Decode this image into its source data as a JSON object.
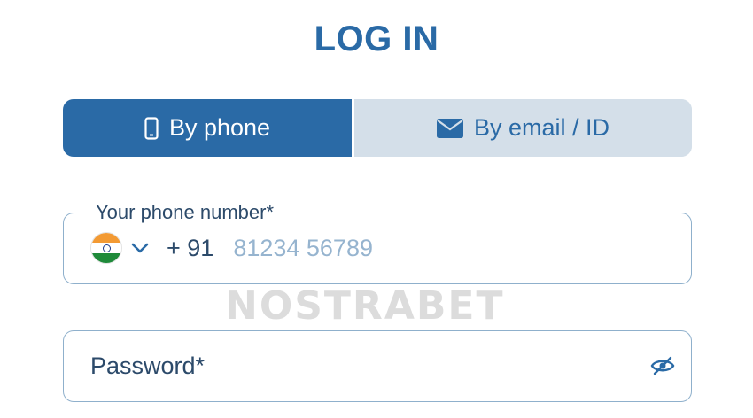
{
  "title": "LOG IN",
  "tabs": [
    {
      "label": "By phone",
      "icon": "smartphone-icon",
      "active": true
    },
    {
      "label": "By email / ID",
      "icon": "envelope-icon",
      "active": false
    }
  ],
  "phone": {
    "legend": "Your phone number*",
    "country_flag": "india-flag-icon",
    "dial_code": "+ 91",
    "placeholder": "81234 56789",
    "value": ""
  },
  "password": {
    "placeholder": "Password*",
    "value": "",
    "toggle_icon": "eye-hidden-icon"
  },
  "watermark": "NOSTRABET",
  "colors": {
    "accent": "#2a6aa6",
    "tab_inactive": "#d4dfe9",
    "border": "#8fb0cc",
    "text": "#2c4a6a",
    "placeholder": "#96b4cf"
  }
}
